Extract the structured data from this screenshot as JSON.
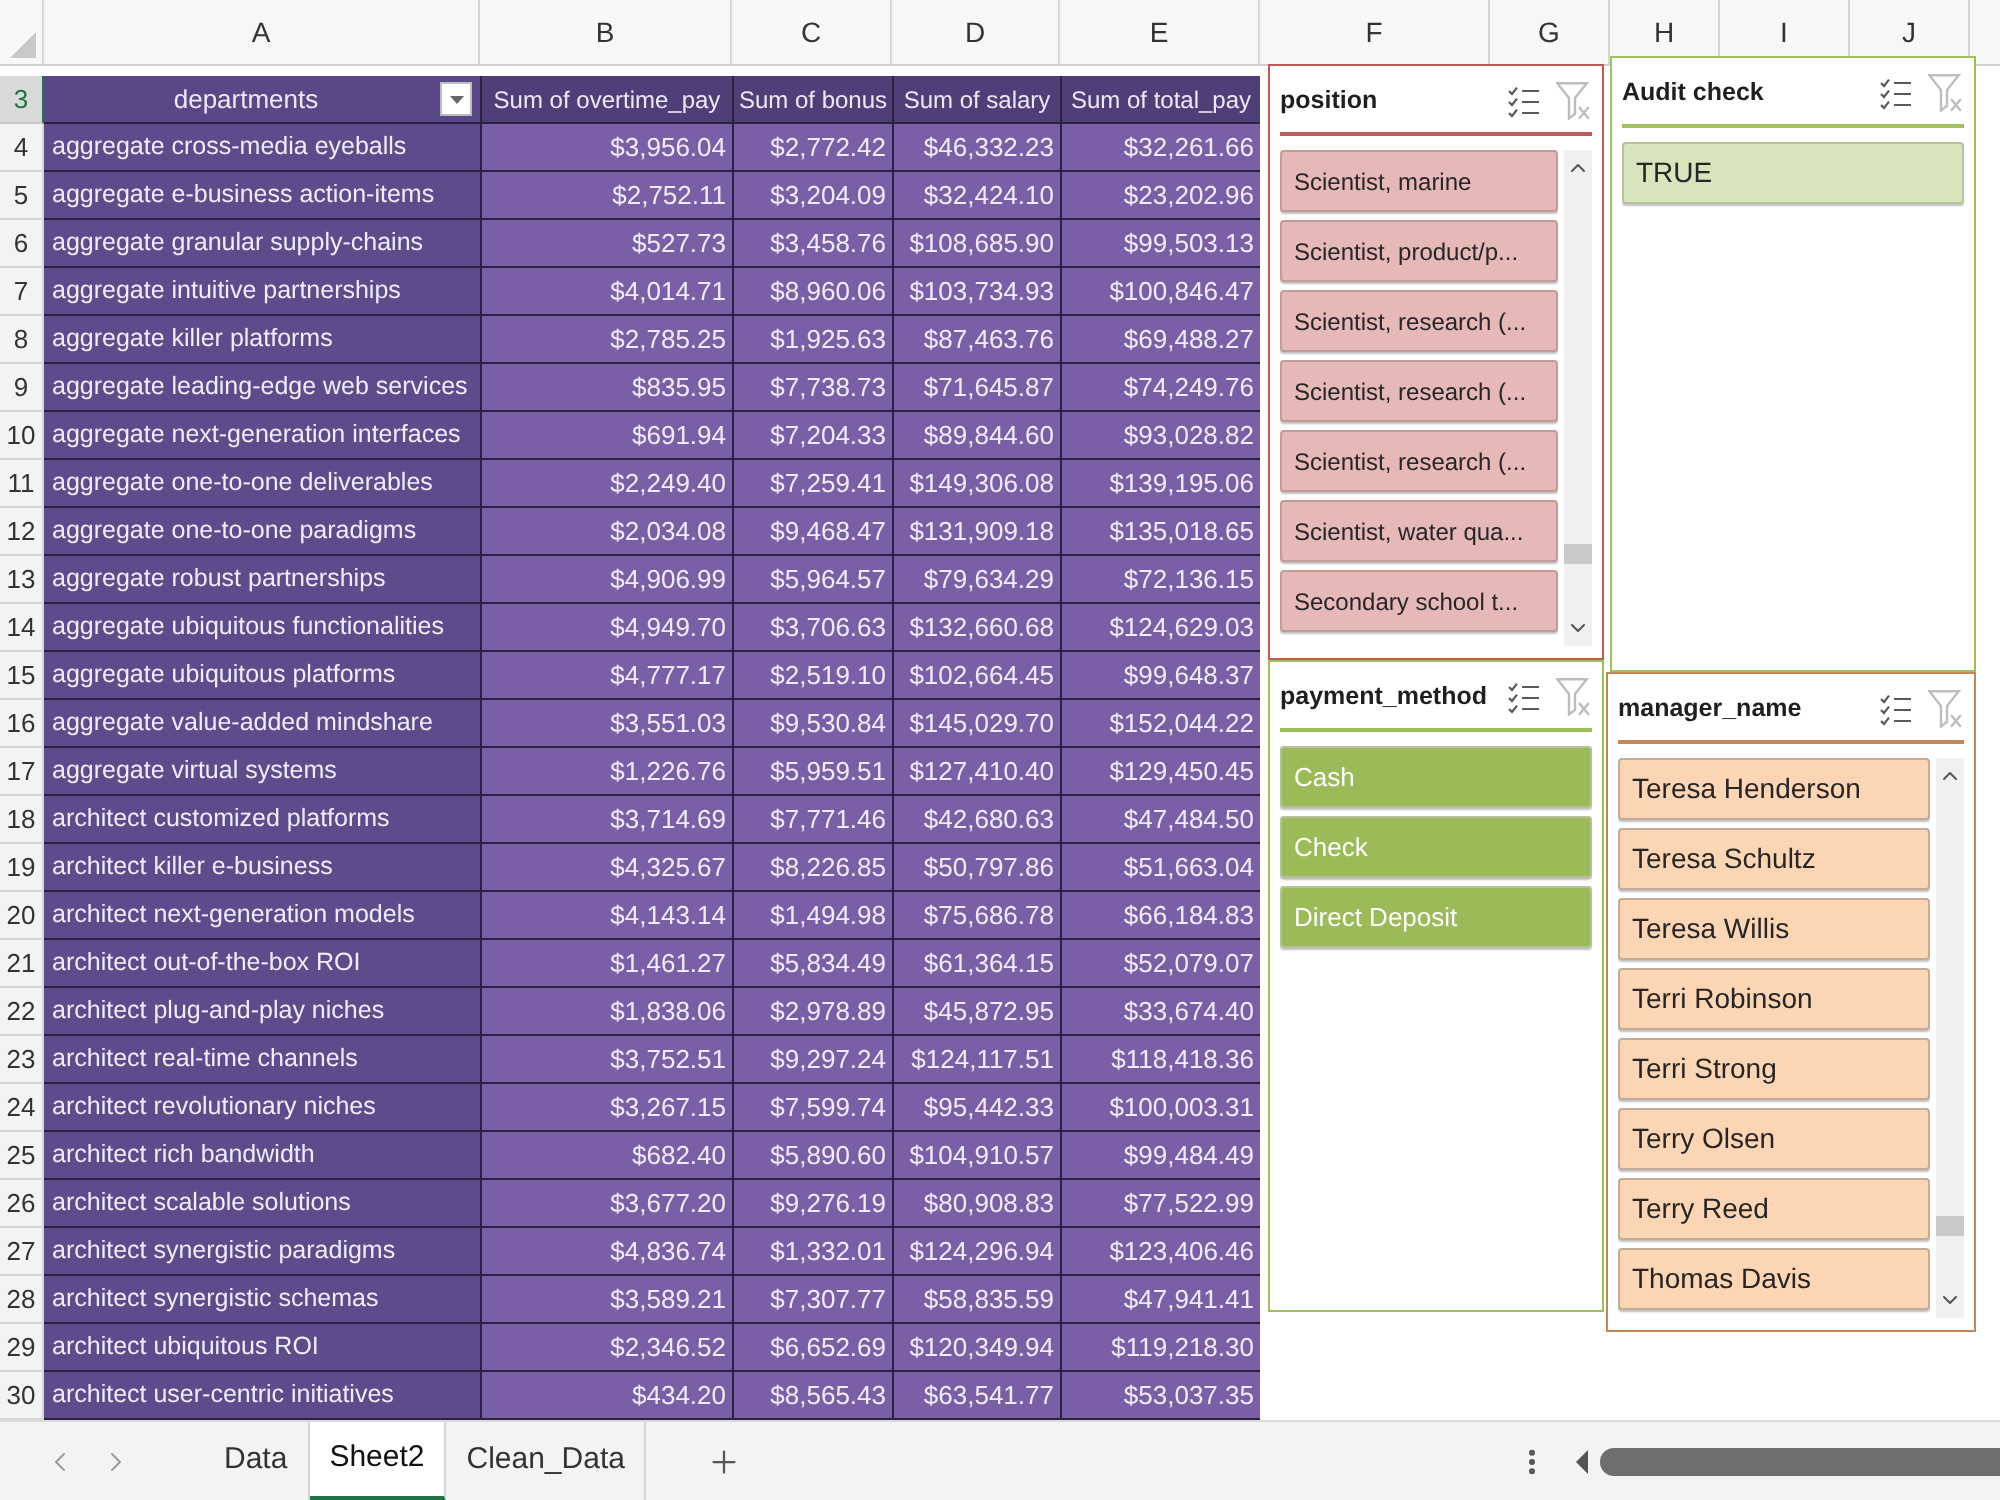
{
  "column_headers": [
    "A",
    "B",
    "C",
    "D",
    "E",
    "F",
    "G",
    "H",
    "I",
    "J"
  ],
  "pivot_table": {
    "header": {
      "row_number": "3",
      "selected": true,
      "cells": [
        "departments",
        "Sum of overtime_pay",
        "Sum of bonus",
        "Sum of salary",
        "Sum of total_pay"
      ]
    },
    "rows": [
      {
        "row_number": "4",
        "selected": false,
        "cells": [
          "aggregate cross-media eyeballs",
          "$3,956.04",
          "$2,772.42",
          "$46,332.23",
          "$32,261.66"
        ]
      },
      {
        "row_number": "5",
        "selected": false,
        "cells": [
          "aggregate e-business action-items",
          "$2,752.11",
          "$3,204.09",
          "$32,424.10",
          "$23,202.96"
        ]
      },
      {
        "row_number": "6",
        "selected": false,
        "cells": [
          "aggregate granular supply-chains",
          "$527.73",
          "$3,458.76",
          "$108,685.90",
          "$99,503.13"
        ]
      },
      {
        "row_number": "7",
        "selected": false,
        "cells": [
          "aggregate intuitive partnerships",
          "$4,014.71",
          "$8,960.06",
          "$103,734.93",
          "$100,846.47"
        ]
      },
      {
        "row_number": "8",
        "selected": false,
        "cells": [
          "aggregate killer platforms",
          "$2,785.25",
          "$1,925.63",
          "$87,463.76",
          "$69,488.27"
        ]
      },
      {
        "row_number": "9",
        "selected": false,
        "cells": [
          "aggregate leading-edge web services",
          "$835.95",
          "$7,738.73",
          "$71,645.87",
          "$74,249.76"
        ]
      },
      {
        "row_number": "10",
        "selected": false,
        "cells": [
          "aggregate next-generation interfaces",
          "$691.94",
          "$7,204.33",
          "$89,844.60",
          "$93,028.82"
        ]
      },
      {
        "row_number": "11",
        "selected": false,
        "cells": [
          "aggregate one-to-one deliverables",
          "$2,249.40",
          "$7,259.41",
          "$149,306.08",
          "$139,195.06"
        ]
      },
      {
        "row_number": "12",
        "selected": false,
        "cells": [
          "aggregate one-to-one paradigms",
          "$2,034.08",
          "$9,468.47",
          "$131,909.18",
          "$135,018.65"
        ]
      },
      {
        "row_number": "13",
        "selected": false,
        "cells": [
          "aggregate robust partnerships",
          "$4,906.99",
          "$5,964.57",
          "$79,634.29",
          "$72,136.15"
        ]
      },
      {
        "row_number": "14",
        "selected": false,
        "cells": [
          "aggregate ubiquitous functionalities",
          "$4,949.70",
          "$3,706.63",
          "$132,660.68",
          "$124,629.03"
        ]
      },
      {
        "row_number": "15",
        "selected": false,
        "cells": [
          "aggregate ubiquitous platforms",
          "$4,777.17",
          "$2,519.10",
          "$102,664.45",
          "$99,648.37"
        ]
      },
      {
        "row_number": "16",
        "selected": false,
        "cells": [
          "aggregate value-added mindshare",
          "$3,551.03",
          "$9,530.84",
          "$145,029.70",
          "$152,044.22"
        ]
      },
      {
        "row_number": "17",
        "selected": false,
        "cells": [
          "aggregate virtual systems",
          "$1,226.76",
          "$5,959.51",
          "$127,410.40",
          "$129,450.45"
        ]
      },
      {
        "row_number": "18",
        "selected": false,
        "cells": [
          "architect customized platforms",
          "$3,714.69",
          "$7,771.46",
          "$42,680.63",
          "$47,484.50"
        ]
      },
      {
        "row_number": "19",
        "selected": false,
        "cells": [
          "architect killer e-business",
          "$4,325.67",
          "$8,226.85",
          "$50,797.86",
          "$51,663.04"
        ]
      },
      {
        "row_number": "20",
        "selected": false,
        "cells": [
          "architect next-generation models",
          "$4,143.14",
          "$1,494.98",
          "$75,686.78",
          "$66,184.83"
        ]
      },
      {
        "row_number": "21",
        "selected": false,
        "cells": [
          "architect out-of-the-box ROI",
          "$1,461.27",
          "$5,834.49",
          "$61,364.15",
          "$52,079.07"
        ]
      },
      {
        "row_number": "22",
        "selected": false,
        "cells": [
          "architect plug-and-play niches",
          "$1,838.06",
          "$2,978.89",
          "$45,872.95",
          "$33,674.40"
        ]
      },
      {
        "row_number": "23",
        "selected": false,
        "cells": [
          "architect real-time channels",
          "$3,752.51",
          "$9,297.24",
          "$124,117.51",
          "$118,418.36"
        ]
      },
      {
        "row_number": "24",
        "selected": false,
        "cells": [
          "architect revolutionary niches",
          "$3,267.15",
          "$7,599.74",
          "$95,442.33",
          "$100,003.31"
        ]
      },
      {
        "row_number": "25",
        "selected": false,
        "cells": [
          "architect rich bandwidth",
          "$682.40",
          "$5,890.60",
          "$104,910.57",
          "$99,484.49"
        ]
      },
      {
        "row_number": "26",
        "selected": false,
        "cells": [
          "architect scalable solutions",
          "$3,677.20",
          "$9,276.19",
          "$80,908.83",
          "$77,522.99"
        ]
      },
      {
        "row_number": "27",
        "selected": false,
        "cells": [
          "architect synergistic paradigms",
          "$4,836.74",
          "$1,332.01",
          "$124,296.94",
          "$123,406.46"
        ]
      },
      {
        "row_number": "28",
        "selected": false,
        "cells": [
          "architect synergistic schemas",
          "$3,589.21",
          "$7,307.77",
          "$58,835.59",
          "$47,941.41"
        ]
      },
      {
        "row_number": "29",
        "selected": false,
        "cells": [
          "architect ubiquitous ROI",
          "$2,346.52",
          "$6,652.69",
          "$120,349.94",
          "$119,218.30"
        ]
      },
      {
        "row_number": "30",
        "selected": false,
        "cells": [
          "architect user-centric initiatives",
          "$434.20",
          "$8,565.43",
          "$63,541.77",
          "$53,037.35"
        ]
      }
    ]
  },
  "slicers": [
    {
      "title": "position",
      "color": "#e6b8b7",
      "scrollbar": true,
      "clear_filter_disabled": true,
      "items": [
        {
          "label": "Scientist, marine",
          "selected": true
        },
        {
          "label": "Scientist, product/p...",
          "selected": true
        },
        {
          "label": "Scientist, research (...",
          "selected": true
        },
        {
          "label": "Scientist, research (...",
          "selected": true
        },
        {
          "label": "Scientist, research (...",
          "selected": true
        },
        {
          "label": "Scientist, water qua...",
          "selected": true
        },
        {
          "label": "Secondary school t...",
          "selected": true
        }
      ]
    },
    {
      "title": "Audit check",
      "color": "#d8e4bc",
      "clear_filter_disabled": true,
      "items": [
        {
          "label": "TRUE",
          "selected": true
        }
      ]
    },
    {
      "title": "payment_method",
      "color": "#9bbb59",
      "clear_filter_disabled": true,
      "items": [
        {
          "label": "Cash",
          "selected": true
        },
        {
          "label": "Check",
          "selected": true
        },
        {
          "label": "Direct Deposit",
          "selected": true
        }
      ]
    },
    {
      "title": "manager_name",
      "color": "#fcd5b4",
      "scrollbar": true,
      "clear_filter_disabled": true,
      "items": [
        {
          "label": "Teresa Henderson",
          "selected": true
        },
        {
          "label": "Teresa Schultz",
          "selected": true
        },
        {
          "label": "Teresa Willis",
          "selected": true
        },
        {
          "label": "Terri Robinson",
          "selected": true
        },
        {
          "label": "Terri Strong",
          "selected": true
        },
        {
          "label": "Terry Olsen",
          "selected": true
        },
        {
          "label": "Terry Reed",
          "selected": true
        },
        {
          "label": "Thomas Davis",
          "selected": true
        }
      ]
    }
  ],
  "sheet_tabs": [
    {
      "label": "Data",
      "selected": false
    },
    {
      "label": "Sheet2",
      "selected": true
    },
    {
      "label": "Clean_Data",
      "selected": false
    }
  ]
}
